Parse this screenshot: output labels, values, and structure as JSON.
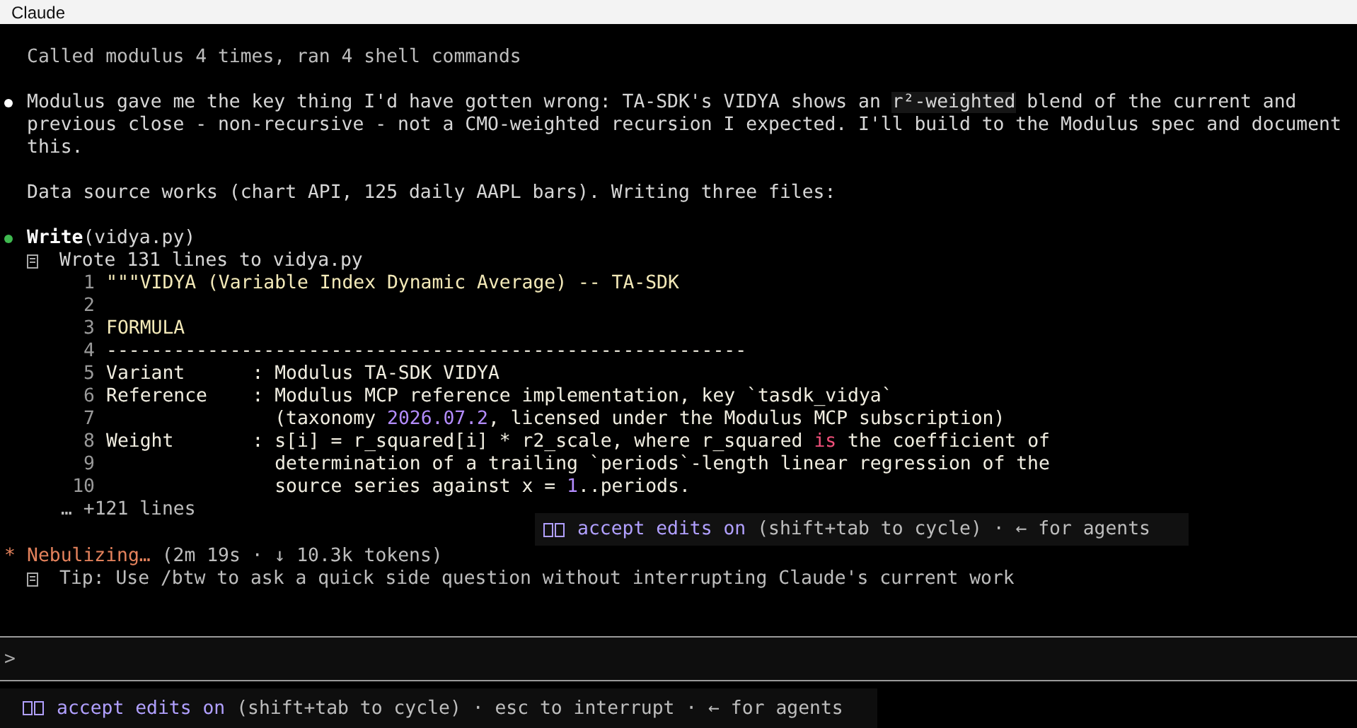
{
  "window": {
    "title": "Claude"
  },
  "summary": "Called modulus 4 times, ran 4 shell commands",
  "message": {
    "lines": [
      [
        {
          "kind": "plain",
          "text": "Modulus gave me the key thing I'd have gotten wrong: TA-SDK's VIDYA shows an "
        },
        {
          "kind": "code",
          "text": "r²-weighted"
        },
        {
          "kind": "plain",
          "text": " blend of the current and"
        }
      ],
      [
        {
          "kind": "plain",
          "text": "previous close - non-recursive - not a CMO-weighted recursion I expected. I'll build to the Modulus spec and document"
        }
      ],
      [
        {
          "kind": "plain",
          "text": "this."
        }
      ]
    ]
  },
  "note": "Data source works (chart API, 125 daily AAPL bars). Writing three files:",
  "tool_call": {
    "name": "Write",
    "args": "(vidya.py)",
    "done": true,
    "result": "Wrote 131 lines to vidya.py",
    "code_lines": [
      {
        "number": "1",
        "segments": [
          {
            "kind": "doc",
            "text": "\"\"\"VIDYA (Variable Index Dynamic Average) -- TA-SDK"
          }
        ]
      },
      {
        "number": "2"
      },
      {
        "number": "3",
        "segments": [
          {
            "kind": "doc",
            "text": "FORMULA"
          }
        ]
      },
      {
        "number": "4",
        "segments": [
          {
            "kind": "plain",
            "text": "---------------------------------------------------------"
          }
        ]
      },
      {
        "number": "5",
        "segments": [
          {
            "kind": "plain",
            "text": "Variant      : Modulus TA-SDK VIDYA"
          }
        ]
      },
      {
        "number": "6",
        "segments": [
          {
            "kind": "plain",
            "text": "Reference    : Modulus MCP reference implementation, key `tasdk_vidya`"
          }
        ]
      },
      {
        "number": "7",
        "segments": [
          {
            "kind": "plain",
            "text": "               (taxonomy "
          },
          {
            "kind": "number",
            "text": "2026.07.2"
          },
          {
            "kind": "plain",
            "text": ", licensed under the Modulus MCP subscription)"
          }
        ]
      },
      {
        "number": "8",
        "segments": [
          {
            "kind": "plain",
            "text": "Weight       : s[i] = r_squared[i] * r2_scale, where r_squared "
          },
          {
            "kind": "keyword",
            "text": "is"
          },
          {
            "kind": "plain",
            "text": " the coefficient of"
          }
        ]
      },
      {
        "number": "9",
        "segments": [
          {
            "kind": "plain",
            "text": "               determination of a trailing `periods`-length linear regression of the"
          }
        ]
      },
      {
        "number": "10",
        "segments": [
          {
            "kind": "plain",
            "text": "               source series against x = "
          },
          {
            "kind": "number",
            "text": "1"
          },
          {
            "kind": "plain",
            "text": "..periods."
          }
        ]
      }
    ],
    "more": "… +121 lines"
  },
  "mode_hint": {
    "mode": "accept edits on",
    "rest": "(shift+tab to cycle) · ← for agents"
  },
  "spinner": {
    "glyph": "*",
    "verb": "Nebulizing…",
    "stats": "(2m 19s · ↓ 10.3k tokens)"
  },
  "tip": "Tip: Use /btw to ask a quick side question without interrupting Claude's current work",
  "prompt": {
    "symbol": ">"
  },
  "status_bar": {
    "mode": "accept edits on",
    "rest": "(shift+tab to cycle) · esc to interrupt · ← for agents"
  }
}
